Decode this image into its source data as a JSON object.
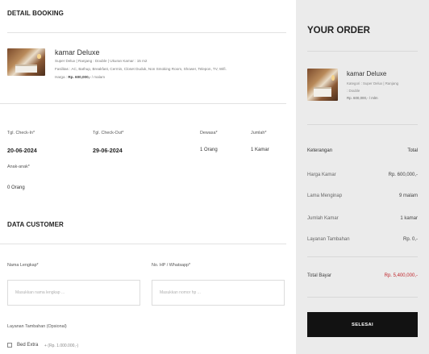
{
  "detail": {
    "title": "DETAIL BOOKING",
    "room": {
      "name": "kamar Deluxe",
      "line1": "Super Delux | Ranjang : Double | Ukuran Kamar : 15 m2",
      "line2": "Fasilitas : AC, Bathup, Breakfast, Cermin, Closet Duduk, Non Smoking Room, Shower, Telepon, TV, Wifi.",
      "price_label": "Harga : ",
      "price_value": "Rp. 600,000,-",
      "price_unit": " / malam"
    },
    "checkin": {
      "label": "Tgl. Check-In*",
      "value": "20-06-2024"
    },
    "checkout": {
      "label": "Tgl. Check-Out*",
      "value": "29-06-2024"
    },
    "adults": {
      "label": "Dewasa*",
      "value": "1 Orang"
    },
    "rooms": {
      "label": "Jumlah*",
      "value": "1 Kamar"
    },
    "children": {
      "label": "Anak-anak*",
      "value": "0 Orang"
    }
  },
  "customer": {
    "title": "DATA CUSTOMER",
    "name_label": "Nama Lengkap*",
    "name_placeholder": "Masukkan nama lengkap ...",
    "phone_label": "No. HP / Whatsapp*",
    "phone_placeholder": "Masukkan nomor hp ...",
    "extra_label": "Layanan Tambahan (Opsional)",
    "extra_option": "Bed Extra",
    "extra_price": "+ (Rp. 1.000.000,-)"
  },
  "order": {
    "title": "YOUR ORDER",
    "room_name": "kamar Deluxe",
    "category": "Kategori : Super Delux | Ranjang",
    "bed": ": Double",
    "price": "Rp. 600,000,- / mlm",
    "head_label": "Keterangan",
    "head_value": "Total",
    "rows": [
      {
        "label": "Harga Kamar",
        "value": "Rp. 600,000,-"
      },
      {
        "label": "Lama Menginap",
        "value": "9 malam"
      },
      {
        "label": "Jumlah Kamar",
        "value": "1 kamar"
      },
      {
        "label": "Layanan Tambahan",
        "value": "Rp. 0,-"
      }
    ],
    "total_label": "Total Bayar",
    "total_value": "Rp. 5,400,000,-",
    "button": "SELESAI"
  }
}
